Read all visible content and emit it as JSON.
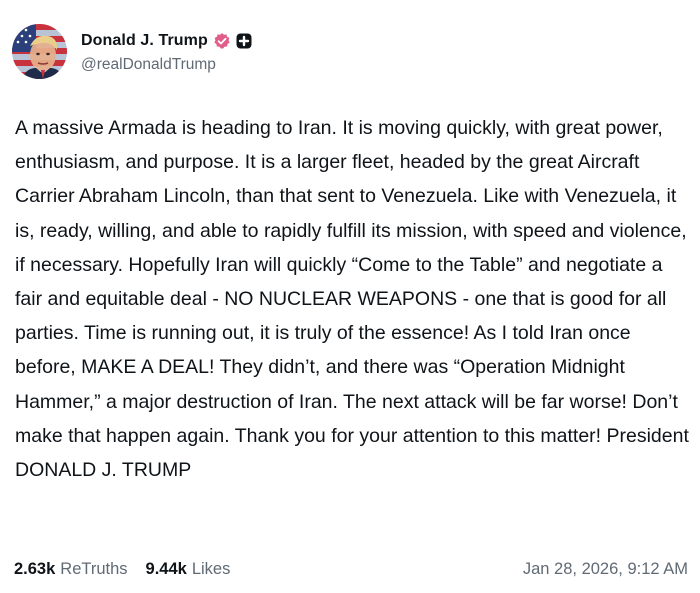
{
  "author": {
    "display_name": "Donald J. Trump",
    "handle": "@realDonaldTrump",
    "avatar_icon": "flag-portrait-avatar",
    "verified_icon": "verified-badge-icon",
    "verified_color": "#e05e8a",
    "plus_icon": "truth-plus-icon"
  },
  "post": {
    "text": "A massive Armada is heading to Iran. It is moving quickly, with great power, enthusiasm, and purpose. It is a larger fleet, headed by the great Aircraft Carrier Abraham Lincoln, than that sent to Venezuela. Like with Venezuela, it is, ready, willing, and able to rapidly fulfill its mission, with speed and violence, if necessary. Hopefully Iran will quickly “Come to the Table” and negotiate a fair and equitable deal - NO NUCLEAR WEAPONS - one that is good for all parties. Time is running out, it is truly of the essence! As I told Iran once before, MAKE A DEAL! They didn’t, and there was “Operation Midnight Hammer,” a major destruction of Iran. The next attack will be far worse! Don’t make that happen again. Thank you for your attention to this matter!  President DONALD J. TRUMP"
  },
  "stats": {
    "retruths_count": "2.63k",
    "retruths_label": "ReTruths",
    "likes_count": "9.44k",
    "likes_label": "Likes"
  },
  "timestamp": "Jan 28, 2026, 9:12 AM"
}
